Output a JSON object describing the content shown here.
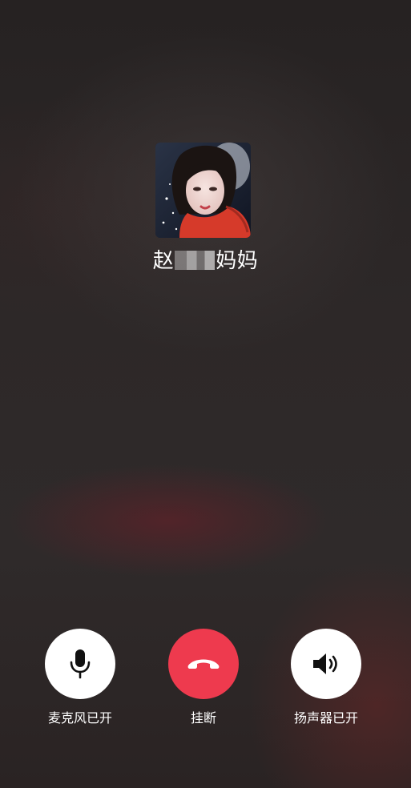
{
  "contact": {
    "name_prefix": "赵",
    "name_suffix": "妈妈",
    "avatar_icon": "contact-avatar-photo"
  },
  "controls": {
    "mic": {
      "label": "麦克风已开",
      "icon": "microphone-icon"
    },
    "hangup": {
      "label": "挂断",
      "icon": "phone-hangup-icon",
      "color": "#ee3a4e"
    },
    "speaker": {
      "label": "扬声器已开",
      "icon": "speaker-icon"
    }
  }
}
